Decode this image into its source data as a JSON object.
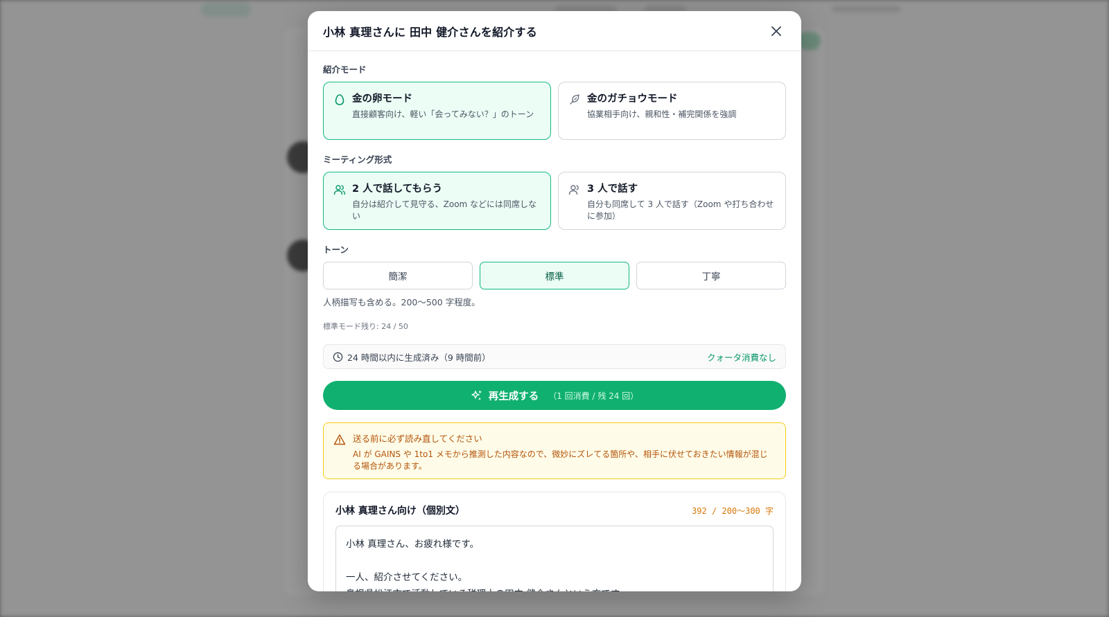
{
  "modal": {
    "title": "小林 真理さんに 田中 健介さんを紹介する",
    "close_icon": "close-icon"
  },
  "intro_mode": {
    "label": "紹介モード",
    "options": [
      {
        "title": "金の卵モード",
        "desc": "直接顧客向け、軽い「会ってみない？」のトーン",
        "icon": "egg-icon",
        "selected": true
      },
      {
        "title": "金のガチョウモード",
        "desc": "協業相手向け、親和性・補完関係を強調",
        "icon": "goose-icon",
        "selected": false
      }
    ]
  },
  "meeting_format": {
    "label": "ミーティング形式",
    "options": [
      {
        "title": "2 人で話してもらう",
        "desc": "自分は紹介して見守る、Zoom などには同席しない",
        "icon": "two-users-icon",
        "selected": true
      },
      {
        "title": "3 人で話す",
        "desc": "自分も同席して 3 人で話す（Zoom や打ち合わせに参加）",
        "icon": "users-icon",
        "selected": false
      }
    ]
  },
  "tone": {
    "label": "トーン",
    "options": [
      "簡潔",
      "標準",
      "丁寧"
    ],
    "selected": "標準",
    "description": "人柄描写も含める。200〜500 字程度。",
    "quota_text": "標準モード残り: 24 / 50"
  },
  "cache": {
    "text": "24 時間以内に生成済み（9 時間前）",
    "note": "クォータ消費なし",
    "icon": "clock-icon"
  },
  "regenerate": {
    "label": "再生成する",
    "sub": "（1 回消費 / 残 24 回）",
    "icon": "sparkles-icon"
  },
  "warning": {
    "title": "送る前に必ず読み直してください",
    "body": "AI が GAINS や 1to1 メモから推測した内容なので、微妙にズレてる箇所や、相手に伏せておきたい情報が混じる場合があります。",
    "icon": "warning-icon"
  },
  "message": {
    "title": "小林 真理さん向け（個別文）",
    "count": "392 / 200〜300 字",
    "lines": [
      "小林 真理さん、お疲れ様です。",
      "",
      "一人、紹介させてください。",
      "島根県松江市で活動している税理士の田中 健介さんという方です。"
    ]
  },
  "colors": {
    "accent": "#10b981",
    "accent_bg": "#ecfdf5",
    "button": "#10b070",
    "warning_border": "#facc15",
    "warning_text": "#b45309",
    "count_text": "#d97706"
  }
}
